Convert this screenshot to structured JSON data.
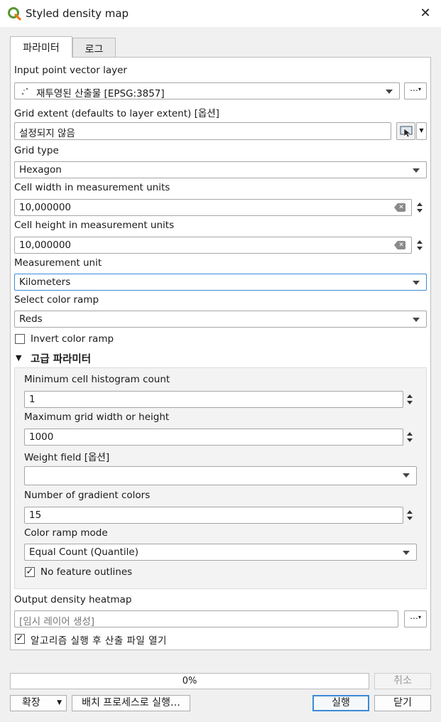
{
  "window": {
    "title": "Styled density map"
  },
  "tabs": [
    {
      "label": "파라미터"
    },
    {
      "label": "로그"
    }
  ],
  "params": {
    "input_layer": {
      "label": "Input point vector layer",
      "value": "재투영된 산출물 [EPSG:3857]"
    },
    "grid_extent": {
      "label": "Grid extent (defaults to layer extent) [옵션]",
      "value": "설정되지 않음"
    },
    "grid_type": {
      "label": "Grid type",
      "value": "Hexagon"
    },
    "cell_width": {
      "label": "Cell width in measurement units",
      "value": "10,000000"
    },
    "cell_height": {
      "label": "Cell height in measurement units",
      "value": "10,000000"
    },
    "measurement_unit": {
      "label": "Measurement unit",
      "value": "Kilometers"
    },
    "color_ramp": {
      "label": "Select color ramp",
      "value": "Reds"
    },
    "invert_color_ramp": {
      "label": "Invert color ramp",
      "checked": false
    }
  },
  "advanced": {
    "header": "고급 파라미터",
    "min_cell_count": {
      "label": "Minimum cell histogram count",
      "value": "1"
    },
    "max_grid": {
      "label": "Maximum grid width or height",
      "value": "1000"
    },
    "weight_field": {
      "label": "Weight field [옵션]",
      "value": ""
    },
    "gradient_colors": {
      "label": "Number of gradient colors",
      "value": "15"
    },
    "color_ramp_mode": {
      "label": "Color ramp mode",
      "value": "Equal Count (Quantile)"
    },
    "no_outlines": {
      "label": "No feature outlines",
      "checked": true
    }
  },
  "output": {
    "label": "Output density heatmap",
    "placeholder": "[임시 레이어 생성]",
    "open_after": {
      "label": "알고리즘 실행 후 산출 파일 열기",
      "checked": true
    }
  },
  "footer": {
    "progress_value": 0,
    "progress_text": "0%",
    "cancel": "취소",
    "advanced": "확장",
    "batch": "배치 프로세스로 실행…",
    "run": "실행",
    "close": "닫기"
  },
  "ellipsis": "…",
  "colors": {
    "accent": "#3c8ad8",
    "qgis_green": "#589632",
    "qgis_yellow": "#ee7913"
  },
  "icons": {
    "close": "close-icon",
    "point_layer": "point-layer-icon",
    "map_select": "map-select-icon",
    "clear": "clear-icon"
  }
}
